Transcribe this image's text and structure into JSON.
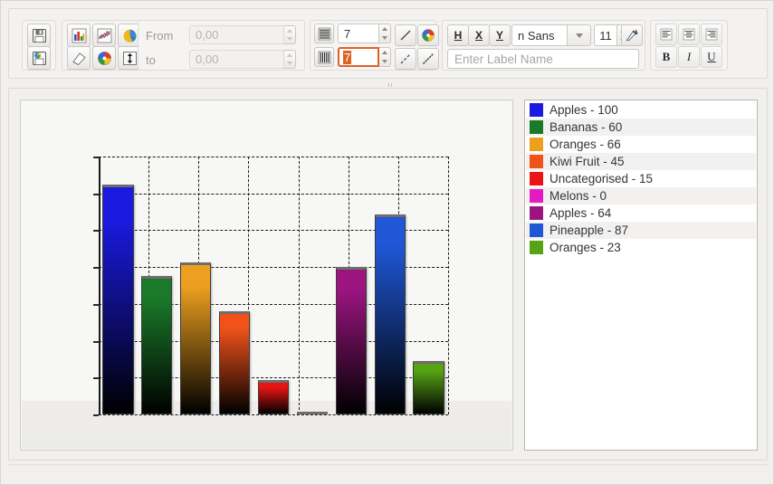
{
  "toolbar": {
    "file_group": {
      "save_label": "save-chart",
      "open_label": "open-chart"
    },
    "type_group": {
      "bar_label": "bar-chart",
      "line_label": "line-chart",
      "pie_label": "pie-chart",
      "area_label": "area-chart",
      "palette_label": "color-palette",
      "resize_label": "fit-vertical"
    },
    "range": {
      "from_label": "From",
      "from_value": "0,00",
      "to_label": "to",
      "to_value": "0,00",
      "enabled": false
    },
    "grid": {
      "horizontal_icon": "horizontal-lines-icon",
      "horizontal_value": "7",
      "vertical_icon": "vertical-lines-icon",
      "vertical_value": "7",
      "vertical_selected": true,
      "line_style_label": "line-style",
      "line_color_label": "line-color",
      "dash_style_label": "dash-style",
      "dot_style_label": "dot-style"
    },
    "text": {
      "header_button": "H",
      "xaxis_button": "X",
      "yaxis_button": "Y",
      "font_family": "n Sans",
      "font_size": "11",
      "font_color_label": "font-color",
      "label_input_placeholder": "Enter Label Name",
      "label_input_value": "",
      "align_left": "align-left",
      "align_center": "align-center",
      "align_right": "align-right",
      "bold": "B",
      "italic": "I",
      "underline": "U"
    }
  },
  "chart_data": {
    "type": "bar",
    "title": "",
    "xlabel": "",
    "ylabel": "",
    "ylim": [
      0,
      112
    ],
    "grid": true,
    "grid_rows": 7,
    "grid_cols": 7,
    "legend_position": "right",
    "categories": [
      "Apples",
      "Bananas",
      "Oranges",
      "Kiwi Fruit",
      "Uncategorised",
      "Melons",
      "Apples",
      "Pineapple",
      "Oranges"
    ],
    "values": [
      100,
      60,
      66,
      45,
      15,
      0,
      64,
      87,
      23
    ],
    "colors": [
      "#1a1ae0",
      "#1a7a2a",
      "#eda020",
      "#f0521a",
      "#ea1414",
      "#e61ac4",
      "#9b1480",
      "#1f57d6",
      "#56a314"
    ],
    "legend": [
      {
        "label": "Apples - 100",
        "name": "Apples",
        "value": 100,
        "color": "#1a1ae0"
      },
      {
        "label": "Bananas - 60",
        "name": "Bananas",
        "value": 60,
        "color": "#1a7a2a"
      },
      {
        "label": "Oranges - 66",
        "name": "Oranges",
        "value": 66,
        "color": "#eda020"
      },
      {
        "label": "Kiwi Fruit - 45",
        "name": "Kiwi Fruit",
        "value": 45,
        "color": "#f0521a"
      },
      {
        "label": "Uncategorised - 15",
        "name": "Uncategorised",
        "value": 15,
        "color": "#ea1414"
      },
      {
        "label": "Melons - 0",
        "name": "Melons",
        "value": 0,
        "color": "#e61ac4"
      },
      {
        "label": "Apples - 64",
        "name": "Apples",
        "value": 64,
        "color": "#9b1480"
      },
      {
        "label": "Pineapple - 87",
        "name": "Pineapple",
        "value": 87,
        "color": "#1f57d6"
      },
      {
        "label": "Oranges - 23",
        "name": "Oranges",
        "value": 23,
        "color": "#56a314"
      }
    ]
  }
}
